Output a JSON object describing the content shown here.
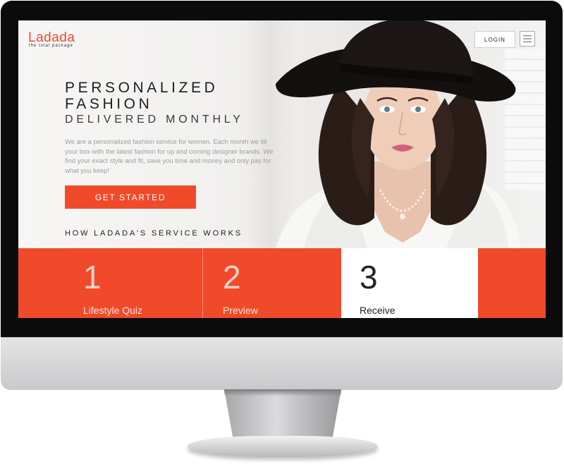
{
  "header": {
    "logo": "Ladada",
    "tagline": "the total package",
    "login_label": "LOGIN"
  },
  "hero": {
    "headline_line1": "PERSONALIZED",
    "headline_line2": "FASHION",
    "subheadline": "DELIVERED MONTHLY",
    "intro": "We are a personalized fashion service for women. Each month we fill your box with the latest fashion for up and coming designer brands. We find your exact style and fit, save you time and money and only pay for what you keep!",
    "cta_label": "GET STARTED"
  },
  "how_it_works": {
    "title": "HOW LADADA'S SERVICE WORKS",
    "steps": [
      {
        "number": "1",
        "label": "Lifestyle Quiz"
      },
      {
        "number": "2",
        "label": "Preview"
      },
      {
        "number": "3",
        "label": "Receive"
      }
    ]
  },
  "icons": {
    "menu": "hamburger-menu-icon"
  },
  "colors": {
    "accent": "#f04a2a",
    "text_dark": "#1d1d1d",
    "text_muted": "#9d9d9d"
  }
}
